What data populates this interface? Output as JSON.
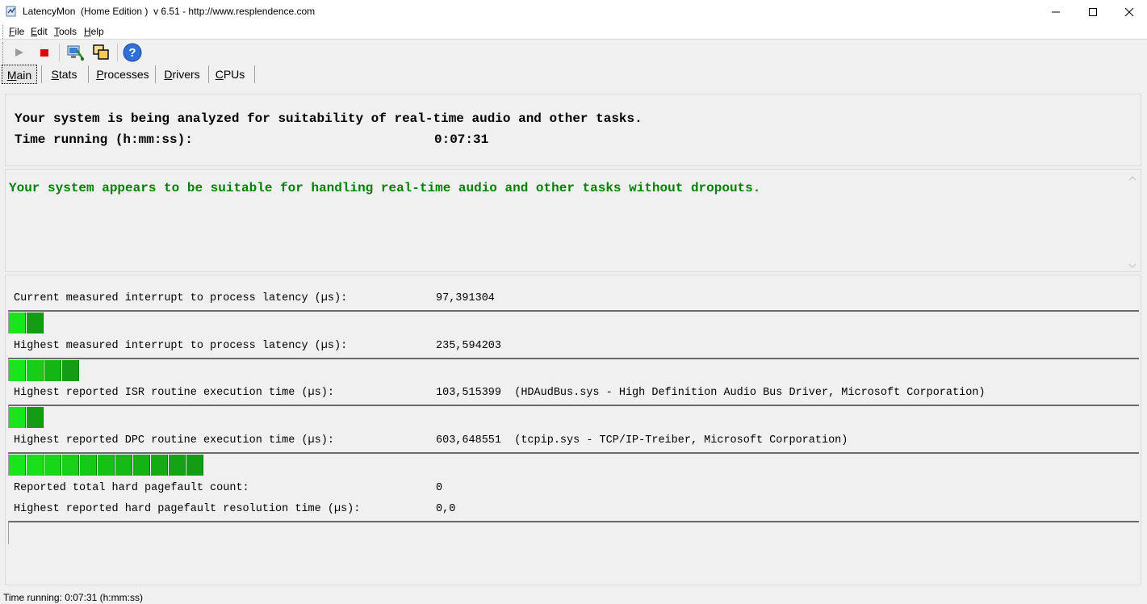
{
  "window": {
    "title": "LatencyMon  (Home Edition )  v 6.51 - http://www.resplendence.com"
  },
  "menu": {
    "items": [
      {
        "key": "F",
        "rest": "ile"
      },
      {
        "key": "E",
        "rest": "dit"
      },
      {
        "key": "T",
        "rest": "ools"
      },
      {
        "key": "H",
        "rest": "elp"
      }
    ]
  },
  "toolbar": {
    "icons": [
      "play-icon",
      "stop-icon",
      "analyze-icon",
      "windows-icon",
      "help-icon"
    ]
  },
  "tabs": [
    {
      "key": "M",
      "rest": "ain",
      "active": true
    },
    {
      "key": "S",
      "rest": "tats",
      "active": false
    },
    {
      "key": "P",
      "rest": "rocesses",
      "active": false
    },
    {
      "key": "D",
      "rest": "rivers",
      "active": false
    },
    {
      "key": "C",
      "rest": "PUs",
      "active": false
    }
  ],
  "status": {
    "analyzing": "Your system is being analyzed for suitability of real-time audio and other tasks.",
    "time_label": "Time running (h:mm:ss):",
    "time_value": "0:07:31"
  },
  "result": {
    "message": "Your system appears to be suitable for handling real-time audio and other tasks without dropouts.",
    "color": "#008000"
  },
  "metrics": [
    {
      "label": "Current measured interrupt to process latency (µs):",
      "value": "97,391304",
      "bar_segments": 2
    },
    {
      "label": "Highest measured interrupt to process latency (µs):",
      "value": "235,594203",
      "bar_segments": 4
    },
    {
      "label": "Highest reported ISR routine execution time (µs):",
      "value": "103,515399  (HDAudBus.sys - High Definition Audio Bus Driver, Microsoft Corporation)",
      "bar_segments": 2
    },
    {
      "label": "Highest reported DPC routine execution time (µs):",
      "value": "603,648551  (tcpip.sys - TCP/IP-Treiber, Microsoft Corporation)",
      "bar_segments": 11
    }
  ],
  "pagefault": {
    "count_label": "Reported total hard pagefault count:",
    "count_value": "0",
    "resolution_label": "Highest reported hard pagefault resolution time (µs):",
    "resolution_value": "0,0",
    "bar_segments": 0
  },
  "statusbar": {
    "text": "Time running: 0:07:31  (h:mm:ss)"
  },
  "colors": {
    "bar_green_light": "#19e619",
    "bar_green_dark": "#138f13",
    "accent_text": "#008000"
  }
}
